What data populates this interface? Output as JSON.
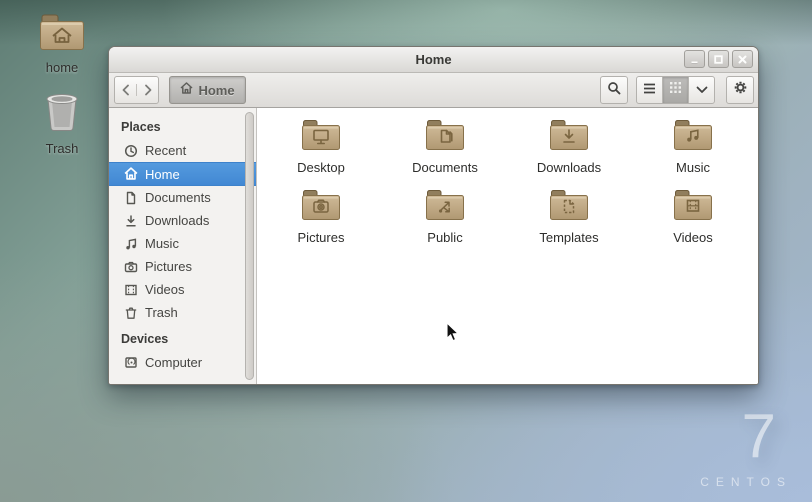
{
  "desktop": {
    "icons": [
      {
        "label": "home",
        "icon": "home-folder-icon"
      },
      {
        "label": "Trash",
        "icon": "trash-icon"
      }
    ],
    "watermark": {
      "numeral": "7",
      "brand": "CENTOS"
    }
  },
  "window": {
    "title": "Home",
    "toolbar": {
      "path_button_label": "Home"
    },
    "sidebar": {
      "sections": [
        {
          "heading": "Places",
          "items": [
            {
              "label": "Recent",
              "icon": "clock-icon",
              "selected": false
            },
            {
              "label": "Home",
              "icon": "home-icon",
              "selected": true
            },
            {
              "label": "Documents",
              "icon": "document-icon",
              "selected": false
            },
            {
              "label": "Downloads",
              "icon": "download-icon",
              "selected": false
            },
            {
              "label": "Music",
              "icon": "music-note-icon",
              "selected": false
            },
            {
              "label": "Pictures",
              "icon": "camera-icon",
              "selected": false
            },
            {
              "label": "Videos",
              "icon": "film-icon",
              "selected": false
            },
            {
              "label": "Trash",
              "icon": "trash-icon",
              "selected": false
            }
          ]
        },
        {
          "heading": "Devices",
          "items": [
            {
              "label": "Computer",
              "icon": "computer-icon",
              "selected": false
            }
          ]
        }
      ]
    },
    "content": {
      "folders": [
        {
          "label": "Desktop",
          "emblem": "monitor-emblem"
        },
        {
          "label": "Documents",
          "emblem": "pages-emblem"
        },
        {
          "label": "Downloads",
          "emblem": "down-arrow-emblem"
        },
        {
          "label": "Music",
          "emblem": "notes-emblem"
        },
        {
          "label": "Pictures",
          "emblem": "camera-emblem"
        },
        {
          "label": "Public",
          "emblem": "share-emblem"
        },
        {
          "label": "Templates",
          "emblem": "dashed-page-emblem"
        },
        {
          "label": "Videos",
          "emblem": "film-emblem"
        }
      ]
    }
  },
  "colors": {
    "selection_blue": "#4a90d9",
    "folder_body": "#c4ae8c",
    "folder_tab": "#93805f",
    "sidebar_bg": "#f3f2f0"
  }
}
